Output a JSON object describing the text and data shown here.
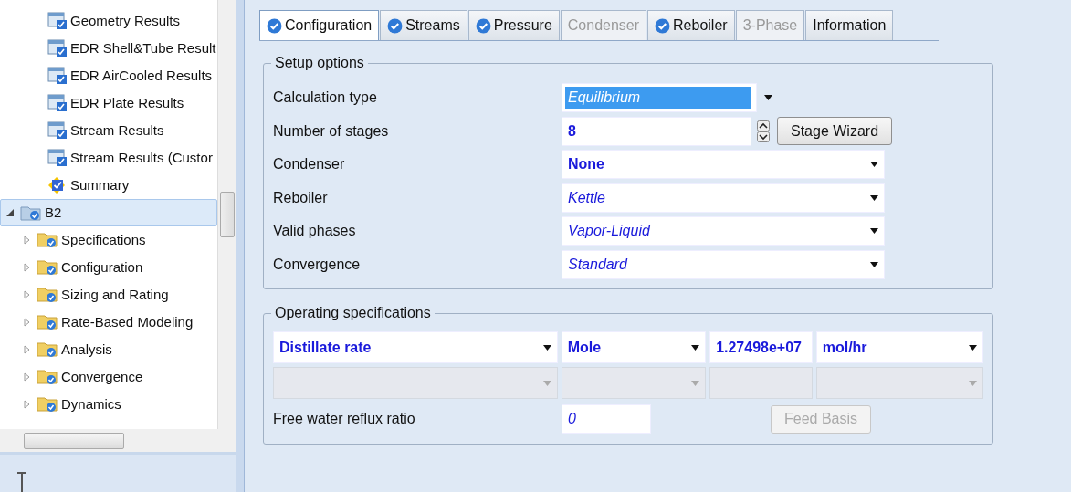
{
  "tree": {
    "items": [
      {
        "label": "Geometry Results",
        "kind": "form"
      },
      {
        "label": "EDR Shell&Tube Result",
        "kind": "form"
      },
      {
        "label": "EDR AirCooled Results",
        "kind": "form"
      },
      {
        "label": "EDR Plate Results",
        "kind": "form"
      },
      {
        "label": "Stream Results",
        "kind": "form"
      },
      {
        "label": "Stream Results (Custor",
        "kind": "form"
      },
      {
        "label": "Summary",
        "kind": "summary"
      },
      {
        "label": "B2",
        "kind": "block",
        "expanded": true,
        "selected": true,
        "children": [
          {
            "label": "Specifications",
            "kind": "folder",
            "expanded": false
          },
          {
            "label": "Configuration",
            "kind": "folder",
            "expanded": false
          },
          {
            "label": "Sizing and Rating",
            "kind": "folder",
            "expanded": false
          },
          {
            "label": "Rate-Based Modeling",
            "kind": "folder",
            "expanded": false
          },
          {
            "label": "Analysis",
            "kind": "folder",
            "expanded": false
          },
          {
            "label": "Convergence",
            "kind": "folder",
            "expanded": false
          },
          {
            "label": "Dynamics",
            "kind": "folder",
            "expanded": false
          }
        ]
      }
    ]
  },
  "tabs": [
    {
      "label": "Configuration",
      "complete": true,
      "disabled": false,
      "selected": true
    },
    {
      "label": "Streams",
      "complete": true,
      "disabled": false,
      "selected": false
    },
    {
      "label": "Pressure",
      "complete": true,
      "disabled": false,
      "selected": false
    },
    {
      "label": "Condenser",
      "complete": false,
      "disabled": true,
      "selected": false
    },
    {
      "label": "Reboiler",
      "complete": true,
      "disabled": false,
      "selected": false
    },
    {
      "label": "3-Phase",
      "complete": false,
      "disabled": true,
      "selected": false
    },
    {
      "label": "Information",
      "complete": false,
      "disabled": false,
      "selected": false
    }
  ],
  "setup_options": {
    "title": "Setup options",
    "rows": [
      {
        "label": "Calculation type",
        "kind": "combo",
        "value": "Equilibrium",
        "user_entered": false,
        "highlighted": true
      },
      {
        "label": "Number of stages",
        "kind": "spin",
        "value": "8",
        "user_entered": true,
        "highlighted": false,
        "button": "Stage Wizard"
      },
      {
        "label": "Condenser",
        "kind": "dropdown",
        "value": "None",
        "user_entered": true,
        "highlighted": false
      },
      {
        "label": "Reboiler",
        "kind": "dropdown",
        "value": "Kettle",
        "user_entered": false,
        "highlighted": false
      },
      {
        "label": "Valid phases",
        "kind": "dropdown",
        "value": "Vapor-Liquid",
        "user_entered": false,
        "highlighted": false
      },
      {
        "label": "Convergence",
        "kind": "dropdown",
        "value": "Standard",
        "user_entered": false,
        "highlighted": false
      }
    ]
  },
  "operating_specifications": {
    "title": "Operating specifications",
    "rows": [
      [
        {
          "kind": "dropdown",
          "value": "Distillate rate",
          "disabled": false
        },
        {
          "kind": "dropdown",
          "value": "Mole",
          "disabled": false
        },
        {
          "kind": "text",
          "value": "1.27498e+07",
          "disabled": false
        },
        {
          "kind": "dropdown",
          "value": "mol/hr",
          "disabled": false
        }
      ],
      [
        {
          "kind": "dropdown",
          "disabled": true
        },
        {
          "kind": "dropdown",
          "disabled": true
        },
        {
          "kind": "text",
          "disabled": true
        },
        {
          "kind": "dropdown",
          "disabled": true
        }
      ]
    ],
    "free_water_reflux_ratio": {
      "label": "Free water reflux ratio",
      "value": "0"
    },
    "feed_basis_button": {
      "label": "Feed Basis",
      "disabled": true
    }
  }
}
